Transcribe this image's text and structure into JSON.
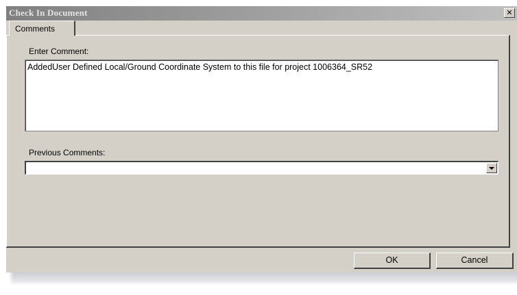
{
  "window": {
    "title": "Check In Document",
    "close_glyph": "✕"
  },
  "tabs": [
    {
      "label": "Comments",
      "selected": true
    }
  ],
  "comments": {
    "enter_label": "Enter Comment:",
    "comment_value": "AddedUser Defined Local/Ground Coordinate System to this file for project 1006364_SR52",
    "previous_label": "Previous Comments:",
    "previous_value": ""
  },
  "buttons": {
    "ok": "OK",
    "cancel": "Cancel"
  },
  "icons": {
    "close": "close-icon",
    "dropdown": "chevron-down-icon"
  },
  "colors": {
    "dialog_face": "#d4d0c8",
    "titlebar_inactive": "#808080",
    "field_background": "#ffffff"
  }
}
